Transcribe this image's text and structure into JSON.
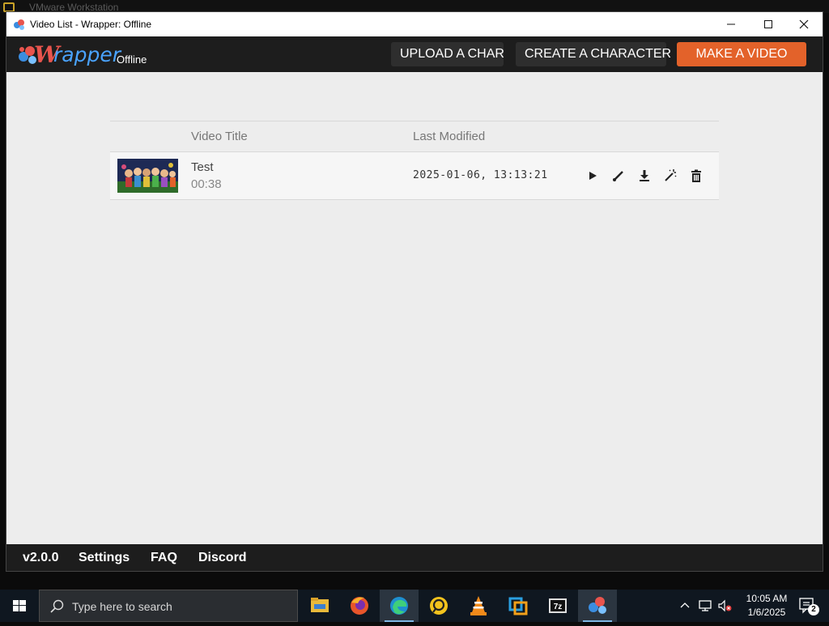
{
  "host": {
    "title": "VMware Workstation"
  },
  "window": {
    "title": "Video List - Wrapper: Offline",
    "controls": {
      "minimize": "minimize-icon",
      "maximize": "maximize-icon",
      "close": "close-icon"
    }
  },
  "header": {
    "logo_w": "W",
    "logo_rest": "rapper",
    "logo_sub": "Offline",
    "buttons": {
      "upload": "UPLOAD A CHAR",
      "create": "CREATE A CHARACTER",
      "make": "MAKE A VIDEO"
    },
    "accent_color": "#e3622a"
  },
  "table": {
    "columns": {
      "title": "Video Title",
      "modified": "Last Modified"
    },
    "rows": [
      {
        "title": "Test",
        "duration": "00:38",
        "modified": "2025-01-06, 13:13:21",
        "actions": [
          "play-icon",
          "edit-brush-icon",
          "download-icon",
          "magic-wand-icon",
          "trash-icon"
        ]
      }
    ]
  },
  "footer": {
    "version": "v2.0.0",
    "settings": "Settings",
    "faq": "FAQ",
    "discord": "Discord"
  },
  "taskbar": {
    "search_placeholder": "Type here to search",
    "apps": [
      "file-explorer-icon",
      "firefox-icon",
      "edge-icon",
      "media-app-icon",
      "vlc-icon",
      "vmware-icon",
      "7zip-icon",
      "wrapper-icon"
    ],
    "time": "10:05 AM",
    "date": "1/6/2025",
    "notifications": "2"
  }
}
